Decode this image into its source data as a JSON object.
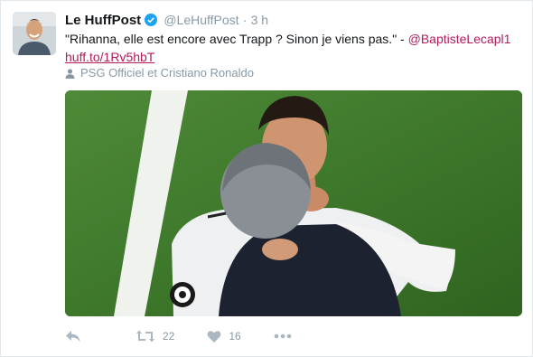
{
  "tweet": {
    "author_name": "Le HuffPost",
    "handle": "@LeHuffPost",
    "separator": "·",
    "time": "3 h",
    "text": "\"Rihanna, elle est encore avec Trapp ? Sinon je viens pas.\" - ",
    "mention": "@BaptisteLecapl1",
    "link": "huff.to/1Rv5hbT",
    "tagged": "PSG Officiel et Cristiano Ronaldo"
  },
  "actions": {
    "retweets": "22",
    "likes": "16"
  },
  "colors": {
    "link": "#b31b5c",
    "muted": "#8899a6",
    "verified": "#1da1f2"
  },
  "icons": [
    "avatar",
    "verified-badge-icon",
    "person-icon",
    "reply-icon",
    "retweet-icon",
    "heart-icon",
    "more-icon"
  ]
}
